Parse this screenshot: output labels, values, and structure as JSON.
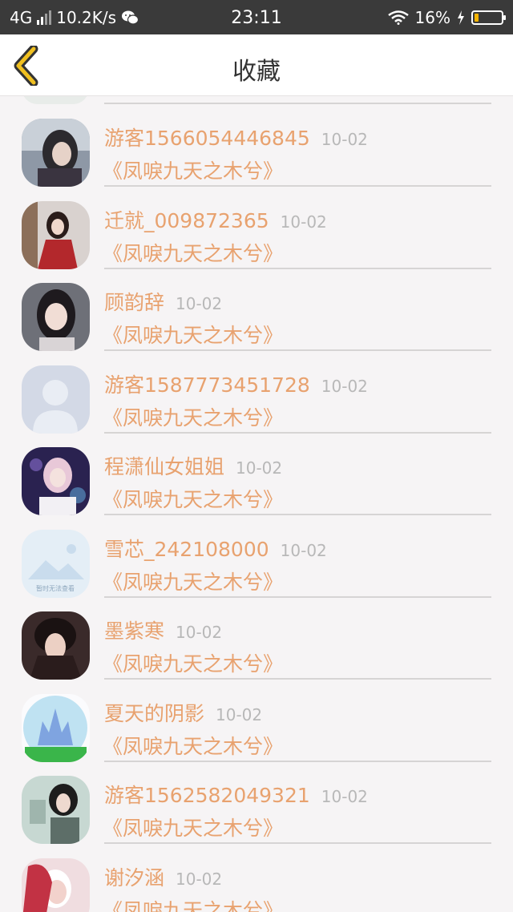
{
  "status_bar": {
    "network": "4G",
    "speed": "10.2K/s",
    "time": "23:11",
    "battery": "16%",
    "battery_level": 0.16,
    "icons": [
      "signal-icon",
      "wechat-icon",
      "wifi-icon",
      "charging-icon",
      "battery-icon"
    ]
  },
  "header": {
    "title": "收藏",
    "back_icon": "chevron-left-icon",
    "accent": "#f0c020"
  },
  "colors": {
    "name": "#e8a26f",
    "book": "#e8a26f",
    "date": "#b8b8b8",
    "background": "#f6f4f5"
  },
  "items": [
    {
      "name": "游客1566054446845",
      "date": "10-02",
      "book": "《凤唳九天之木兮》",
      "avatar": "photo-avatar"
    },
    {
      "name": "迁就_009872365",
      "date": "10-02",
      "book": "《凤唳九天之木兮》",
      "avatar": "photo-avatar"
    },
    {
      "name": "顾韵辞",
      "date": "10-02",
      "book": "《凤唳九天之木兮》",
      "avatar": "photo-avatar"
    },
    {
      "name": "游客1587773451728",
      "date": "10-02",
      "book": "《凤唳九天之木兮》",
      "avatar": "default-avatar"
    },
    {
      "name": "程潇仙女姐姐",
      "date": "10-02",
      "book": "《凤唳九天之木兮》",
      "avatar": "photo-avatar"
    },
    {
      "name": "雪芯_242108000",
      "date": "10-02",
      "book": "《凤唳九天之木兮》",
      "avatar": "placeholder-image",
      "avatar_caption": "暂时无法查看"
    },
    {
      "name": "墨紫寒",
      "date": "10-02",
      "book": "《凤唳九天之木兮》",
      "avatar": "photo-avatar"
    },
    {
      "name": "夏天的阴影",
      "date": "10-02",
      "book": "《凤唳九天之木兮》",
      "avatar": "photo-avatar"
    },
    {
      "name": "游客1562582049321",
      "date": "10-02",
      "book": "《凤唳九天之木兮》",
      "avatar": "photo-avatar"
    },
    {
      "name": "谢汐涵",
      "date": "10-02",
      "book": "《凤唳九天之木兮》",
      "avatar": "photo-avatar"
    }
  ]
}
